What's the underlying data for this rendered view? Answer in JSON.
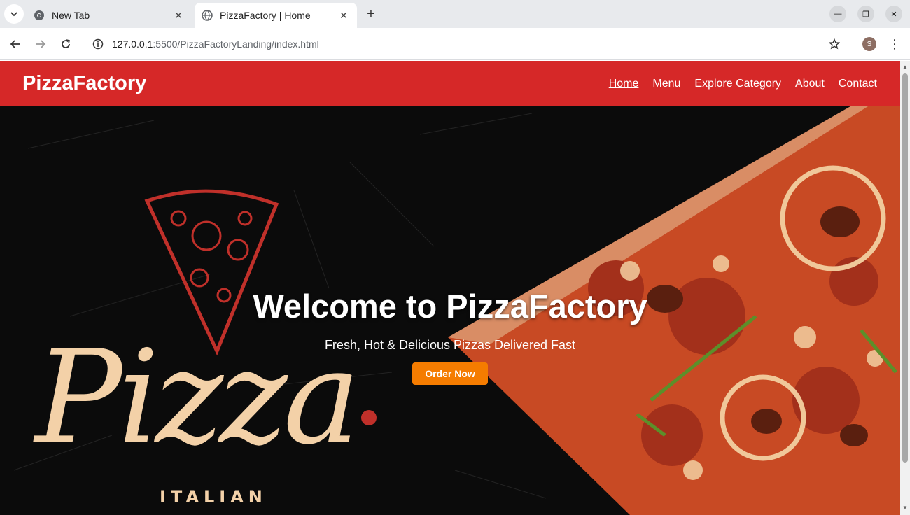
{
  "browser": {
    "tabs": [
      {
        "title": "New Tab",
        "active": false
      },
      {
        "title": "PizzaFactory | Home",
        "active": true
      }
    ],
    "url_host": "127.0.0.1",
    "url_path": ":5500/PizzaFactoryLanding/index.html",
    "profile_initial": "S"
  },
  "site": {
    "logo": "PizzaFactory",
    "nav": [
      {
        "label": "Home",
        "current": true
      },
      {
        "label": "Menu",
        "current": false
      },
      {
        "label": "Explore Category",
        "current": false
      },
      {
        "label": "About",
        "current": false
      },
      {
        "label": "Contact",
        "current": false
      }
    ],
    "hero": {
      "title": "Welcome to PizzaFactory",
      "subtitle": "Fresh, Hot & Delicious Pizzas Delivered Fast",
      "cta": "Order Now",
      "image_text": "Pizza",
      "image_tagline": "ITALIAN"
    }
  },
  "colors": {
    "header": "#d62828",
    "cta": "#f57c00",
    "hero_bg": "#0b0b0b"
  }
}
